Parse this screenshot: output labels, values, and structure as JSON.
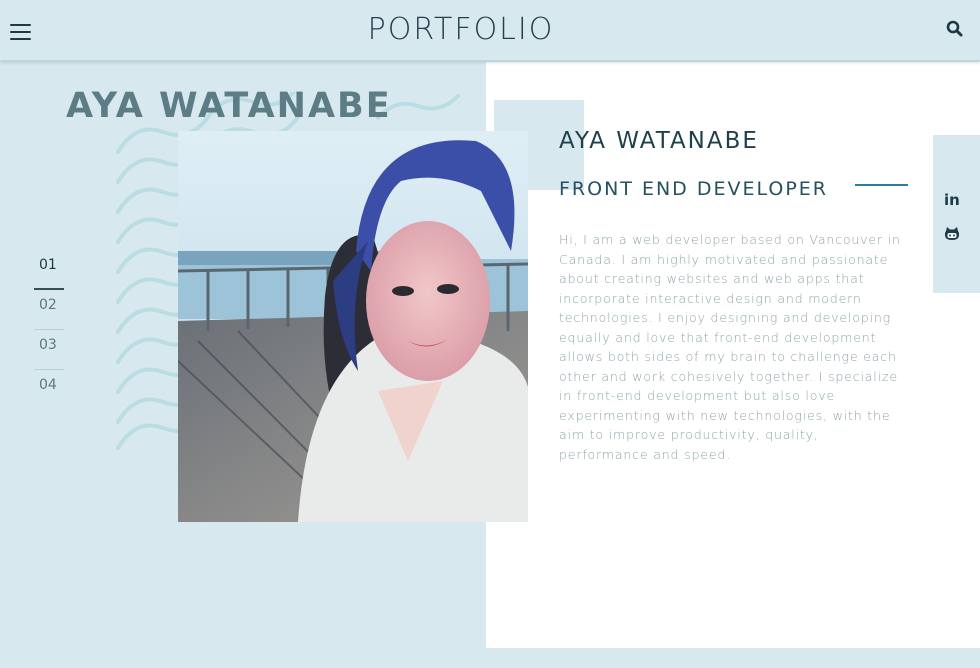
{
  "header": {
    "logo": "PORTFOLIO",
    "menu_icon": "hamburger-menu-icon",
    "search_icon": "search-icon"
  },
  "hero": {
    "big_name": "AYA WATANABE",
    "photo": "profile-photo"
  },
  "nav": {
    "items": [
      {
        "label": "01",
        "active": true
      },
      {
        "label": "02",
        "active": false
      },
      {
        "label": "03",
        "active": false
      },
      {
        "label": "04",
        "active": false
      }
    ]
  },
  "about": {
    "name": "AYA WATANABE",
    "role": "FRONT END DEVELOPER",
    "bio": "Hi,  I am a web developer based on Vancouver in Canada. I am highly motivated and passionate about creating websites and web apps that incorporate interactive design and modern technologies. I enjoy designing and developing equally and love that front-end development allows both sides of my brain to challenge each other and work cohesively together. I specialize in front-end development but also love experimenting with new technologies, with the aim to improve productivity, quality, performance and speed."
  },
  "social": {
    "linkedin_label": "in",
    "linkedin_icon": "linkedin-icon",
    "github_icon": "github-icon"
  },
  "colors": {
    "background": "#d7e9ef",
    "panel": "#ffffff",
    "accent_line": "#2a7ea6",
    "heading": "#1f3f4b"
  }
}
